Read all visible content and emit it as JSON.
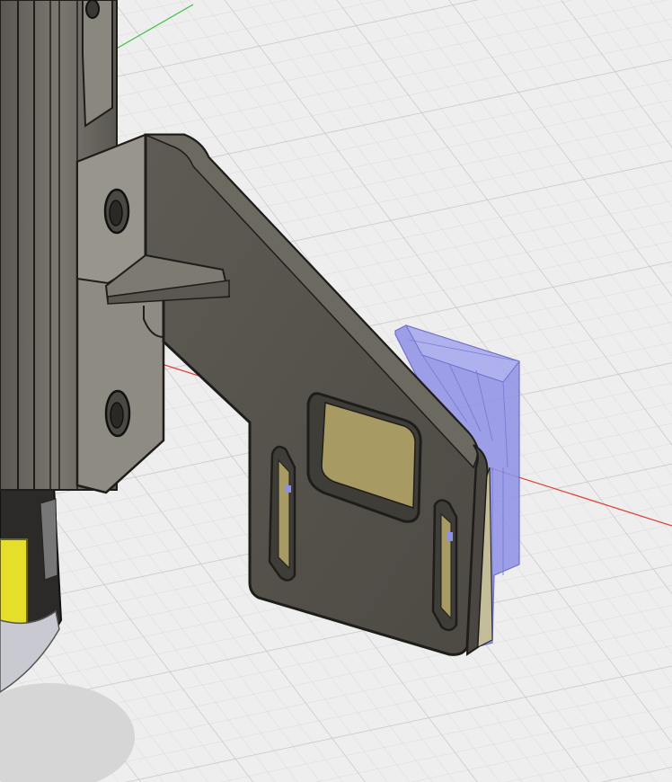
{
  "viewport": {
    "background_color": "#eeeeee",
    "grid_minor_color": "#d9d9d9",
    "grid_major_color": "#c6c6c6",
    "x_axis_color": "#e0403a",
    "y_axis_color": "#3cc03c"
  },
  "model": {
    "bracket_color": "#5b5850",
    "bracket_edge_color": "#1e1d1a",
    "extrusion_color": "#6d6a63",
    "part_transparent_color": "#8f91e8",
    "window_fill_color": "#a89a63",
    "highlight_yellow": "#e5df2b"
  }
}
